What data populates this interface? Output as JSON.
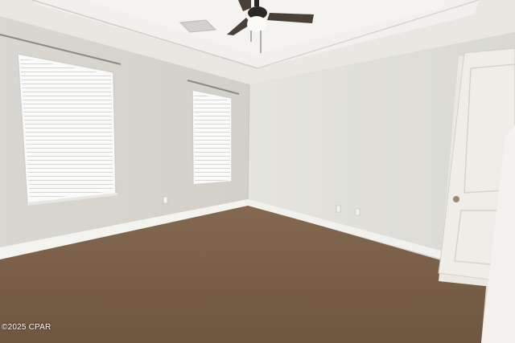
{
  "photo": {
    "subject": "empty-bedroom",
    "watermark": "©2025 CPAR"
  },
  "colors": {
    "ceiling": "#e7e6e1",
    "tray_ceiling": "#efeeea",
    "left_wall": "#dcdad3",
    "back_wall": "#e2e1dc",
    "carpet": "#80644a",
    "baseboard": "#f2f2ef",
    "door": "#ecebe6",
    "fan_blade": "#4a4038"
  },
  "icons": [
    "ceiling-fan-icon",
    "door-knob-icon",
    "outlet-icon"
  ]
}
